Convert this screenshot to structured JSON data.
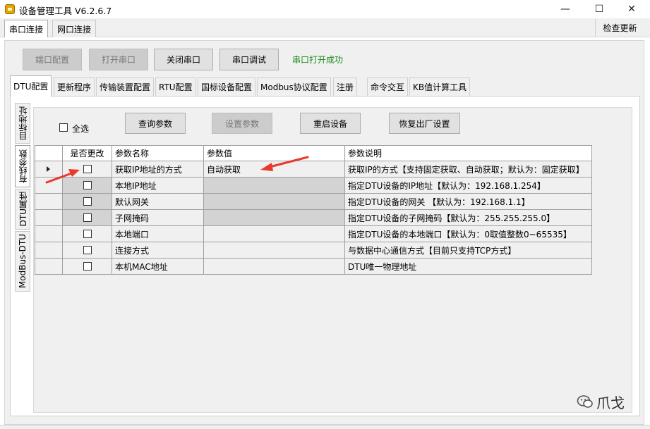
{
  "window": {
    "title": "设备管理工具 V6.2.6.7",
    "minimize": "—",
    "maximize": "☐",
    "close": "✕"
  },
  "top_tabs": [
    "串口连接",
    "网口连接"
  ],
  "check_update": "检查更新",
  "toolbar": {
    "port_config": "端口配置",
    "open_port": "打开串口",
    "close_port": "关闭串口",
    "port_debug": "串口调试",
    "status": "串口打开成功"
  },
  "inner_tabs": [
    "DTU配置",
    "更新程序",
    "传输装置配置",
    "RTU配置",
    "国标设备配置",
    "Modbus协议配置",
    "注册",
    "命令交互",
    "KB值计算工具"
  ],
  "vertical_tabs": [
    "目标地址",
    "有线参数",
    "DTU属性",
    "ModBus-DTU"
  ],
  "actions": {
    "select_all": "全选",
    "query": "查询参数",
    "set": "设置参数",
    "restart": "重启设备",
    "factory_reset": "恢复出厂设置"
  },
  "table": {
    "headers": [
      "是否更改",
      "参数名称",
      "参数值",
      "参数说明"
    ],
    "rows": [
      {
        "name": "获取IP地址的方式",
        "value": "自动获取",
        "desc": "获取IP的方式【支持固定获取、自动获取；默认为：固定获取】"
      },
      {
        "name": "本地IP地址",
        "value": "",
        "desc": "指定DTU设备的IP地址【默认为：192.168.1.254】"
      },
      {
        "name": "默认网关",
        "value": "",
        "desc": "指定DTU设备的网关 【默认为：192.168.1.1】"
      },
      {
        "name": "子网掩码",
        "value": "",
        "desc": "指定DTU设备的子网掩码【默认为：255.255.255.0】"
      },
      {
        "name": "本地端口",
        "value": "",
        "desc": "指定DTU设备的本地端口【默认为：0取值整数0~65535】"
      },
      {
        "name": "连接方式",
        "value": "",
        "desc": "与数据中心通信方式【目前只支持TCP方式】"
      },
      {
        "name": "本机MAC地址",
        "value": "",
        "desc": "DTU唯一物理地址"
      }
    ]
  },
  "watermark": "爪戈",
  "colors": {
    "status_green": "#1a8a1a",
    "arrow_red": "#e8392c",
    "disabled_grey": "#d3d3d3"
  }
}
